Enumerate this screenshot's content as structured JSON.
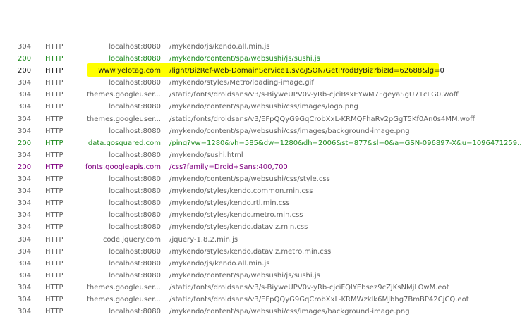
{
  "rows": [
    {
      "status": "304",
      "protocol": "HTTP",
      "host": "localhost:8080",
      "url": "/mykendo/js/kendo.all.min.js",
      "tone": "st-304"
    },
    {
      "status": "200",
      "protocol": "HTTP",
      "host": "localhost:8080",
      "url": "/mykendo/content/spa/websushi/js/sushi.js",
      "tone": "st-200g"
    },
    {
      "status": "200",
      "protocol": "HTTP",
      "host": "www.yelotag.com",
      "url": "/light/BizRef-Web-DomainService1.svc/JSON/GetProdByBiz?bizId=62688&lg=0",
      "tone": "st-200",
      "highlight": true
    },
    {
      "status": "304",
      "protocol": "HTTP",
      "host": "localhost:8080",
      "url": "/mykendo/styles/Metro/loading-image.gif",
      "tone": "st-304"
    },
    {
      "status": "304",
      "protocol": "HTTP",
      "host": "themes.googleuser...",
      "url": "/static/fonts/droidsans/v3/s-BiyweUPV0v-yRb-cjciBsxEYwM7FgeyaSgU71cLG0.woff",
      "tone": "st-304"
    },
    {
      "status": "304",
      "protocol": "HTTP",
      "host": "localhost:8080",
      "url": "/mykendo/content/spa/websushi/css/images/logo.png",
      "tone": "st-304"
    },
    {
      "status": "304",
      "protocol": "HTTP",
      "host": "themes.googleuser...",
      "url": "/static/fonts/droidsans/v3/EFpQQyG9GqCrobXxL-KRMQFhaRv2pGgT5Kf0An0s4MM.woff",
      "tone": "st-304"
    },
    {
      "status": "304",
      "protocol": "HTTP",
      "host": "localhost:8080",
      "url": "/mykendo/content/spa/websushi/css/images/background-image.png",
      "tone": "st-304"
    },
    {
      "status": "200",
      "protocol": "HTTP",
      "host": "data.gosquared.com",
      "url": "/ping?vw=1280&vh=585&dw=1280&dh=2006&st=877&sl=0&a=GSN-096897-X&u=1096471259...",
      "tone": "st-200g"
    },
    {
      "status": "304",
      "protocol": "HTTP",
      "host": "localhost:8080",
      "url": "/mykendo/sushi.html",
      "tone": "st-304"
    },
    {
      "status": "200",
      "protocol": "HTTP",
      "host": "fonts.googleapis.com",
      "url": "/css?family=Droid+Sans:400,700",
      "tone": "st-200p"
    },
    {
      "status": "304",
      "protocol": "HTTP",
      "host": "localhost:8080",
      "url": "/mykendo/content/spa/websushi/css/style.css",
      "tone": "st-304"
    },
    {
      "status": "304",
      "protocol": "HTTP",
      "host": "localhost:8080",
      "url": "/mykendo/styles/kendo.common.min.css",
      "tone": "st-304"
    },
    {
      "status": "304",
      "protocol": "HTTP",
      "host": "localhost:8080",
      "url": "/mykendo/styles/kendo.rtl.min.css",
      "tone": "st-304"
    },
    {
      "status": "304",
      "protocol": "HTTP",
      "host": "localhost:8080",
      "url": "/mykendo/styles/kendo.metro.min.css",
      "tone": "st-304"
    },
    {
      "status": "304",
      "protocol": "HTTP",
      "host": "localhost:8080",
      "url": "/mykendo/styles/kendo.dataviz.min.css",
      "tone": "st-304"
    },
    {
      "status": "304",
      "protocol": "HTTP",
      "host": "code.jquery.com",
      "url": "/jquery-1.8.2.min.js",
      "tone": "st-304"
    },
    {
      "status": "304",
      "protocol": "HTTP",
      "host": "localhost:8080",
      "url": "/mykendo/styles/kendo.dataviz.metro.min.css",
      "tone": "st-304"
    },
    {
      "status": "304",
      "protocol": "HTTP",
      "host": "localhost:8080",
      "url": "/mykendo/js/kendo.all.min.js",
      "tone": "st-304"
    },
    {
      "status": "304",
      "protocol": "HTTP",
      "host": "localhost:8080",
      "url": "/mykendo/content/spa/websushi/js/sushi.js",
      "tone": "st-304"
    },
    {
      "status": "304",
      "protocol": "HTTP",
      "host": "themes.googleuser...",
      "url": "/static/fonts/droidsans/v3/s-BiyweUPV0v-yRb-cjciFQlYEbsez9cZjKsNMjLOwM.eot",
      "tone": "st-304"
    },
    {
      "status": "304",
      "protocol": "HTTP",
      "host": "themes.googleuser...",
      "url": "/static/fonts/droidsans/v3/EFpQQyG9GqCrobXxL-KRMWzklk6MJbhg7BmBP42CjCQ.eot",
      "tone": "st-304"
    },
    {
      "status": "304",
      "protocol": "HTTP",
      "host": "localhost:8080",
      "url": "/mykendo/content/spa/websushi/css/images/background-image.png",
      "tone": "st-304"
    }
  ],
  "colors": {
    "status304": "#5f5f5f",
    "status200": "#1e8a1e",
    "status200font": "#800080",
    "highlight": "#ffff00"
  }
}
